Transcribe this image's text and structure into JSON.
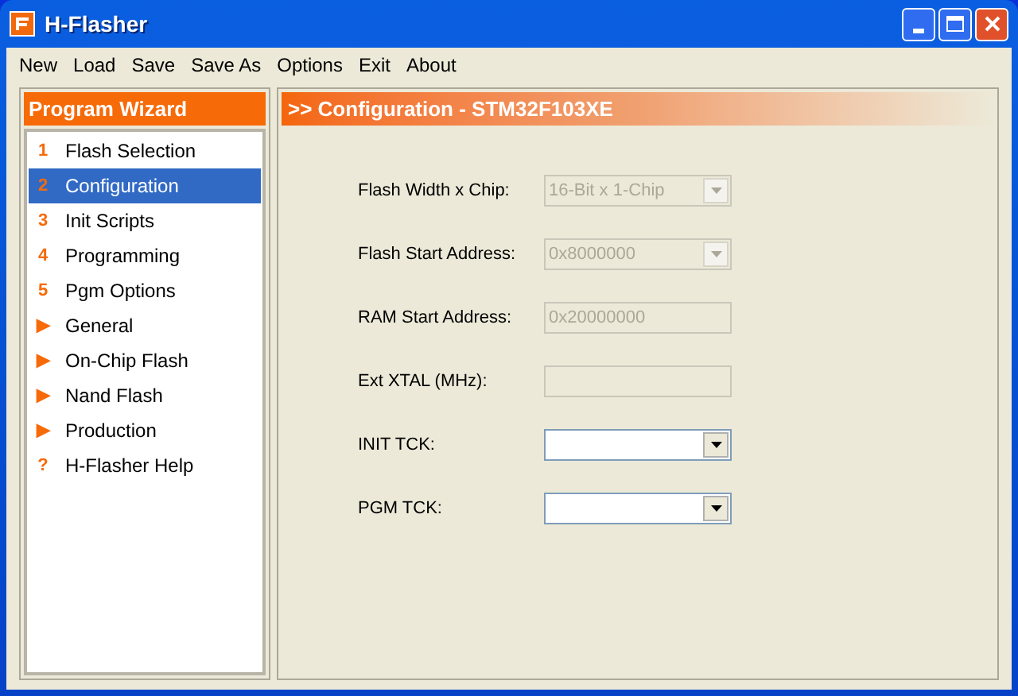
{
  "window": {
    "title": "H-Flasher"
  },
  "menu": [
    "New",
    "Load",
    "Save",
    "Save As",
    "Options",
    "Exit",
    "About"
  ],
  "sidebar": {
    "title": "Program Wizard",
    "items": [
      {
        "marker": "1",
        "label": "Flash Selection",
        "selected": false
      },
      {
        "marker": "2",
        "label": "Configuration",
        "selected": true
      },
      {
        "marker": "3",
        "label": "Init Scripts",
        "selected": false
      },
      {
        "marker": "4",
        "label": "Programming",
        "selected": false
      },
      {
        "marker": "5",
        "label": "Pgm Options",
        "selected": false
      },
      {
        "marker": "▶",
        "label": "General",
        "selected": false
      },
      {
        "marker": "▶",
        "label": "On-Chip Flash",
        "selected": false
      },
      {
        "marker": "▶",
        "label": "Nand Flash",
        "selected": false
      },
      {
        "marker": "▶",
        "label": "Production",
        "selected": false
      },
      {
        "marker": "?",
        "label": "H-Flasher Help",
        "selected": false
      }
    ]
  },
  "panel": {
    "title": ">> Configuration - STM32F103XE",
    "fields": [
      {
        "label": "Flash Width x Chip:",
        "kind": "combo",
        "value": "16-Bit x 1-Chip",
        "disabled": true
      },
      {
        "label": "Flash Start Address:",
        "kind": "combo",
        "value": "0x8000000",
        "disabled": true
      },
      {
        "label": "RAM Start Address:",
        "kind": "text",
        "value": "0x20000000",
        "disabled": true
      },
      {
        "label": "Ext XTAL (MHz):",
        "kind": "text",
        "disabled": true
      },
      {
        "label": "INIT TCK:",
        "kind": "combo",
        "disabled": false
      },
      {
        "label": "PGM TCK:",
        "kind": "combo",
        "disabled": false
      }
    ]
  }
}
